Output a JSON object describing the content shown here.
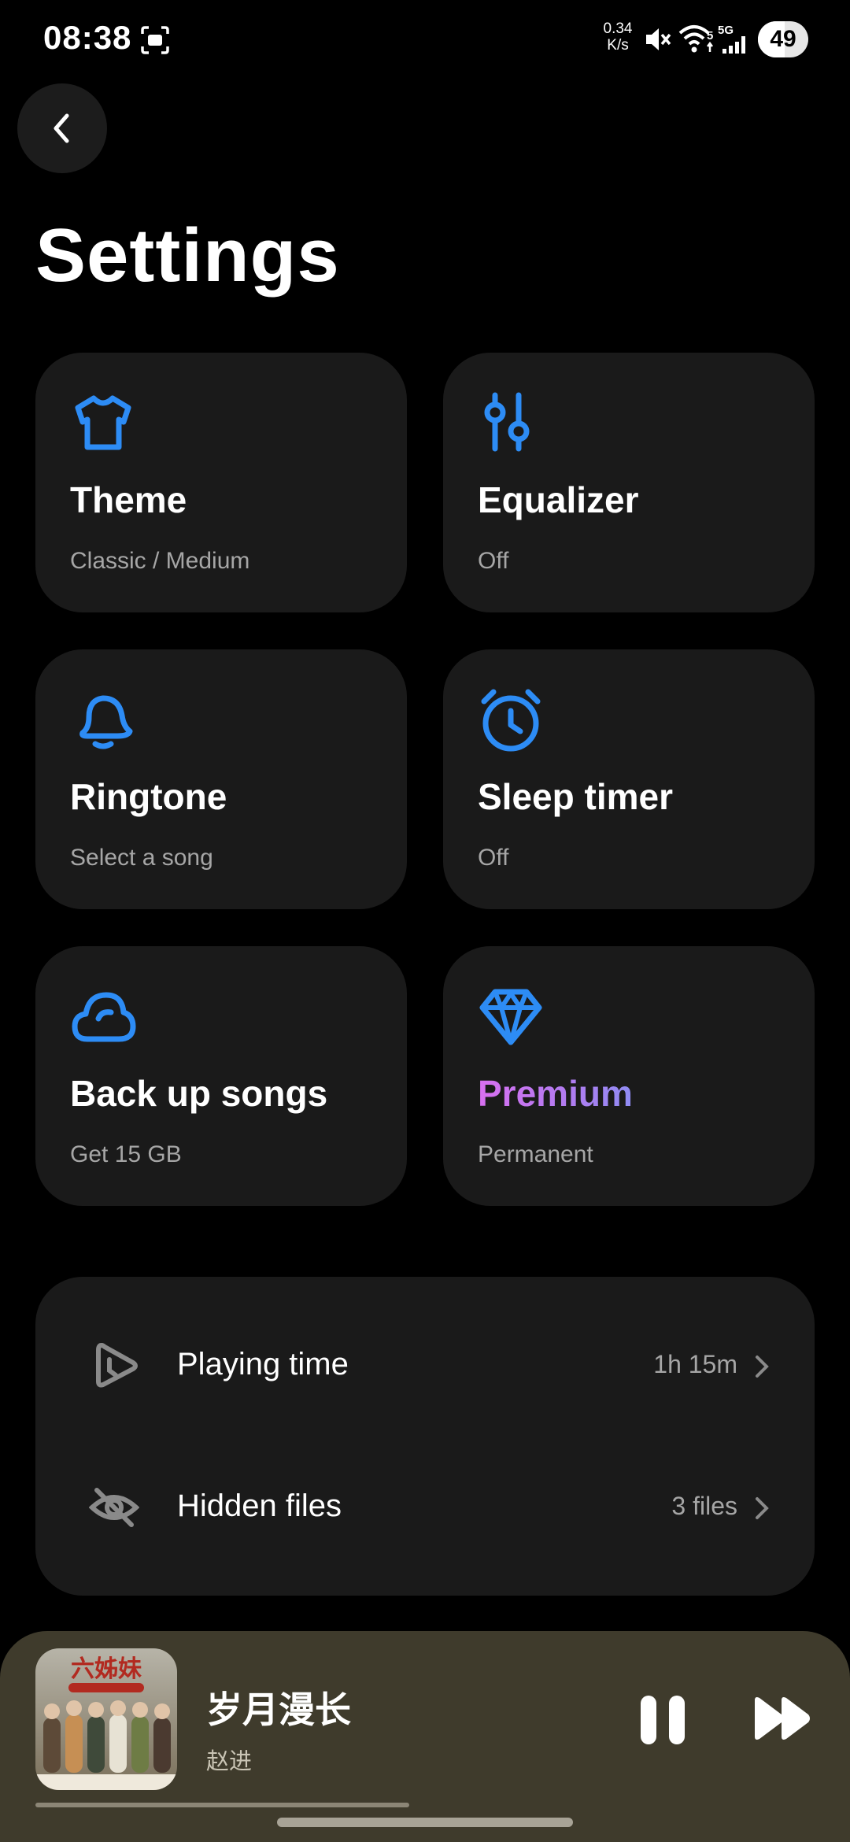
{
  "status_bar": {
    "time": "08:38",
    "net_speed_value": "0.34",
    "net_speed_unit": "K/s",
    "signal_label": "5G",
    "battery": "49"
  },
  "page": {
    "title": "Settings"
  },
  "cards": [
    {
      "title": "Theme",
      "subtitle": "Classic / Medium",
      "icon": "tshirt-icon"
    },
    {
      "title": "Equalizer",
      "subtitle": "Off",
      "icon": "sliders-icon"
    },
    {
      "title": "Ringtone",
      "subtitle": "Select a song",
      "icon": "bell-icon"
    },
    {
      "title": "Sleep timer",
      "subtitle": "Off",
      "icon": "alarm-clock-icon"
    },
    {
      "title": "Back up songs",
      "subtitle": "Get 15 GB",
      "icon": "cloud-icon"
    },
    {
      "title": "Premium",
      "subtitle": "Permanent",
      "icon": "diamond-icon"
    }
  ],
  "list": [
    {
      "label": "Playing time",
      "value": "1h 15m",
      "icon": "play-clock-icon"
    },
    {
      "label": "Hidden files",
      "value": "3 files",
      "icon": "eye-off-icon"
    }
  ],
  "player": {
    "song": "岁月漫长",
    "artist": "赵进",
    "album_art_caption": "六姊妹",
    "progress_fraction": 0.33
  },
  "colors": {
    "accent": "#2d8cf5",
    "card_bg": "#1a1a1a",
    "player_bg": "#3f3b2c",
    "premium_gradient_start": "#d86ff0",
    "premium_gradient_end": "#8f8cf3"
  }
}
